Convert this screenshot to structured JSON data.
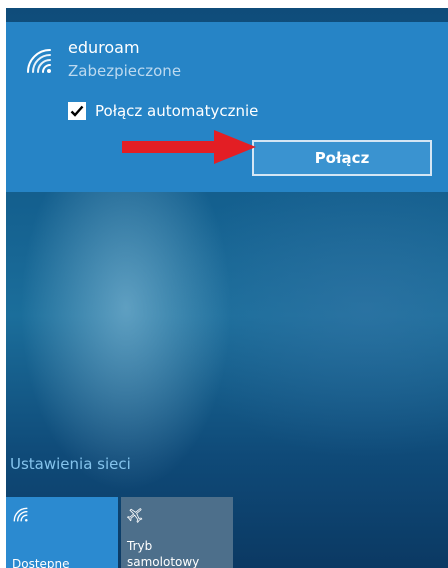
{
  "network": {
    "ssid": "eduroam",
    "security": "Zabezpieczone",
    "auto_connect_label": "Połącz automatycznie",
    "auto_connect_checked": true,
    "connect_label": "Połącz",
    "icon": "wifi-icon"
  },
  "annotation": {
    "icon": "red-arrow",
    "color": "#e31e24"
  },
  "settings_link": "Ustawienia sieci",
  "quick_actions": [
    {
      "label_lines": [
        "Dostępne"
      ],
      "icon": "wifi-icon",
      "active": true,
      "color": "#2b8ad0"
    },
    {
      "label_lines": [
        "Tryb",
        "samolotowy"
      ],
      "icon": "airplane-icon",
      "active": false,
      "color": "#4d6f8b"
    }
  ],
  "colors": {
    "accent": "#2684c6",
    "link": "#84c3ec",
    "button_border": "#d4e6f4"
  }
}
